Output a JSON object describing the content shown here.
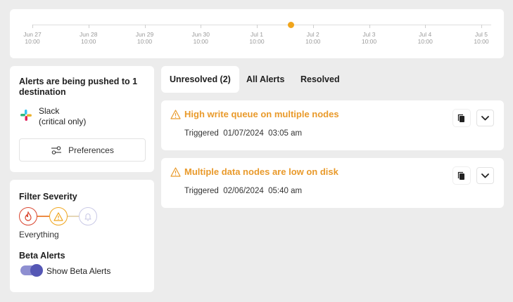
{
  "timeline": {
    "ticks": [
      {
        "date": "Jun 27",
        "time": "10:00"
      },
      {
        "date": "Jun 28",
        "time": "10:00"
      },
      {
        "date": "Jun 29",
        "time": "10:00"
      },
      {
        "date": "Jun 30",
        "time": "10:00"
      },
      {
        "date": "Jul 1",
        "time": "10:00"
      },
      {
        "date": "Jul 2",
        "time": "10:00"
      },
      {
        "date": "Jul 3",
        "time": "10:00"
      },
      {
        "date": "Jul 4",
        "time": "10:00"
      },
      {
        "date": "Jul 5",
        "time": "10:00"
      }
    ],
    "marker_color": "#f0a51c"
  },
  "destinations": {
    "title": "Alerts are being pushed to 1 destination",
    "channel": {
      "name": "Slack",
      "detail": "(critical only)",
      "icon": "slack-icon"
    },
    "preferences_label": "Preferences"
  },
  "filter": {
    "title": "Filter Severity",
    "levels": [
      {
        "name": "critical",
        "icon": "flame-icon",
        "color": "#d9452f"
      },
      {
        "name": "warning",
        "icon": "warning-icon",
        "color": "#f0a51c"
      },
      {
        "name": "info",
        "icon": "bell-icon",
        "color": "#c9c9e6"
      }
    ],
    "selected_label": "Everything",
    "beta_title": "Beta Alerts",
    "beta_toggle_label": "Show Beta Alerts",
    "beta_enabled": true
  },
  "tabs": [
    {
      "label": "Unresolved (2)",
      "active": true
    },
    {
      "label": "All Alerts",
      "active": false
    },
    {
      "label": "Resolved",
      "active": false
    }
  ],
  "alerts": [
    {
      "title": "High write queue on multiple nodes",
      "triggered_label": "Triggered",
      "triggered_at": "01/07/2024  03:05 am"
    },
    {
      "title": "Multiple data nodes are low on disk",
      "triggered_label": "Triggered",
      "triggered_at": "02/06/2024  05:40 am"
    }
  ],
  "colors": {
    "accent_warning": "#e99a2b",
    "toggle_on": "#5557b5"
  }
}
